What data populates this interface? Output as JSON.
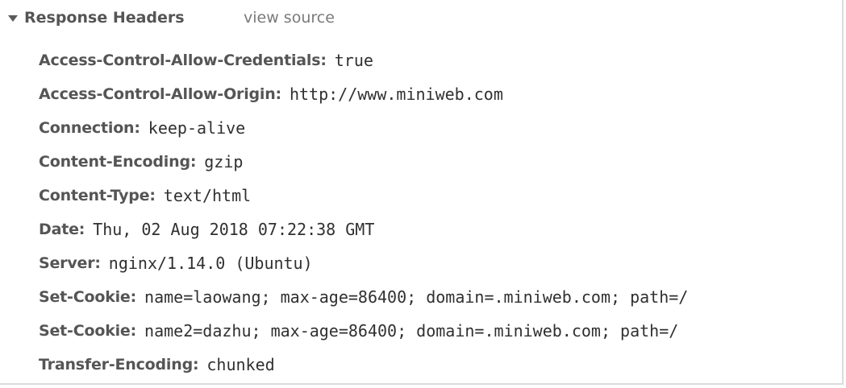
{
  "section": {
    "title": "Response Headers",
    "view_source_label": "view source"
  },
  "headers": [
    {
      "name": "Access-Control-Allow-Credentials:",
      "value": "true"
    },
    {
      "name": "Access-Control-Allow-Origin:",
      "value": "http://www.miniweb.com"
    },
    {
      "name": "Connection:",
      "value": "keep-alive"
    },
    {
      "name": "Content-Encoding:",
      "value": "gzip"
    },
    {
      "name": "Content-Type:",
      "value": "text/html"
    },
    {
      "name": "Date:",
      "value": "Thu, 02 Aug 2018 07:22:38 GMT"
    },
    {
      "name": "Server:",
      "value": "nginx/1.14.0 (Ubuntu)"
    },
    {
      "name": "Set-Cookie:",
      "value": "name=laowang; max-age=86400; domain=.miniweb.com; path=/"
    },
    {
      "name": "Set-Cookie:",
      "value": "name2=dazhu; max-age=86400; domain=.miniweb.com; path=/"
    },
    {
      "name": "Transfer-Encoding:",
      "value": "chunked"
    }
  ]
}
